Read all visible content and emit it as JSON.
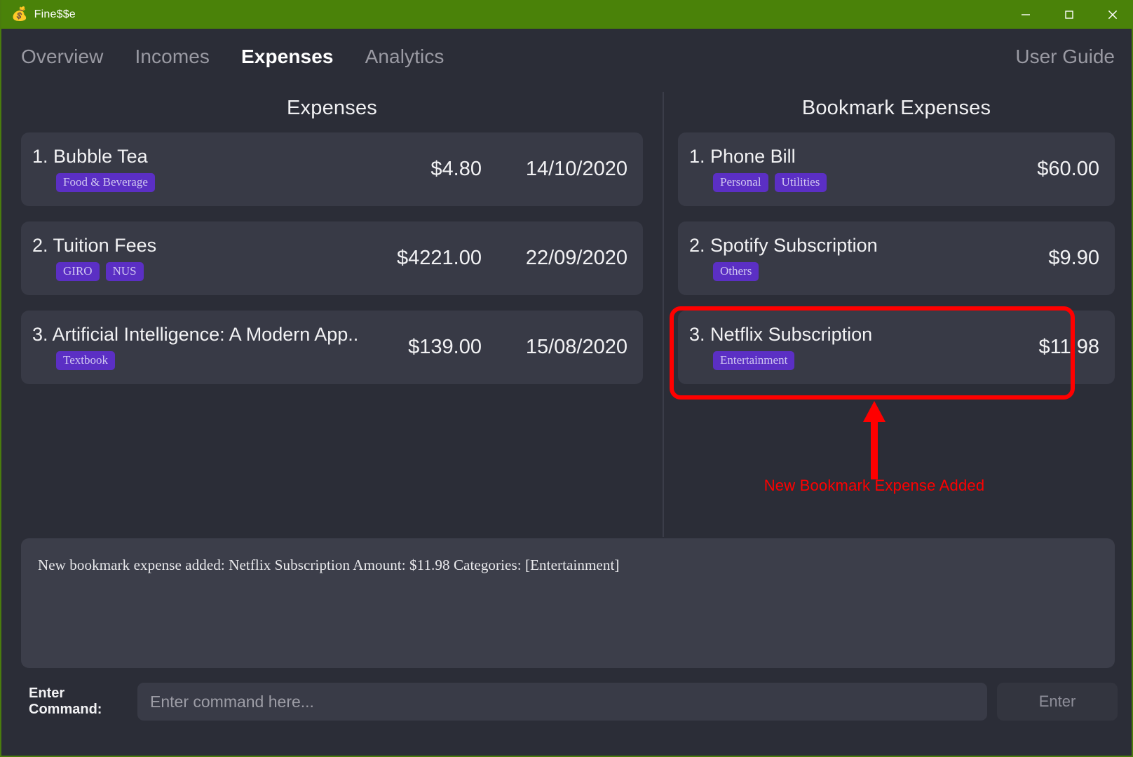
{
  "window": {
    "icon": "money-bag-icon",
    "title": "Fine$$e",
    "controls": {
      "minimize": "minimize-icon",
      "maximize": "maximize-icon",
      "close": "close-icon"
    },
    "titlebar_color": "#4a8209"
  },
  "nav": {
    "tabs": [
      {
        "label": "Overview",
        "active": false
      },
      {
        "label": "Incomes",
        "active": false
      },
      {
        "label": "Expenses",
        "active": true
      },
      {
        "label": "Analytics",
        "active": false
      }
    ],
    "right_link": "User Guide"
  },
  "panels": {
    "expenses": {
      "heading": "Expenses",
      "items": [
        {
          "index": "1.",
          "title": "Bubble Tea",
          "tags": [
            "Food & Beverage"
          ],
          "amount": "$4.80",
          "date": "14/10/2020"
        },
        {
          "index": "2.",
          "title": "Tuition Fees",
          "tags": [
            "GIRO",
            "NUS"
          ],
          "amount": "$4221.00",
          "date": "22/09/2020"
        },
        {
          "index": "3.",
          "title": "Artificial Intelligence: A Modern App...",
          "tags": [
            "Textbook"
          ],
          "amount": "$139.00",
          "date": "15/08/2020"
        }
      ]
    },
    "bookmark_expenses": {
      "heading": "Bookmark Expenses",
      "items": [
        {
          "index": "1.",
          "title": "Phone Bill",
          "tags": [
            "Personal",
            "Utilities"
          ],
          "amount": "$60.00",
          "highlighted": false
        },
        {
          "index": "2.",
          "title": "Spotify Subscription",
          "tags": [
            "Others"
          ],
          "amount": "$9.90",
          "highlighted": false
        },
        {
          "index": "3.",
          "title": "Netflix Subscription",
          "tags": [
            "Entertainment"
          ],
          "amount": "$11.98",
          "highlighted": true
        }
      ]
    }
  },
  "console": {
    "lines": [
      "New bookmark expense added: Netflix Subscription Amount: $11.98 Categories: [Entertainment]"
    ]
  },
  "command_bar": {
    "label": "Enter Command:",
    "input_value": "",
    "input_placeholder": "Enter command here...",
    "button_label": "Enter"
  },
  "annotation": {
    "color": "#ff0000",
    "text": "New Bookmark Expense Added",
    "arrow": "up-arrow-icon",
    "target": "Netflix Subscription bookmark card"
  },
  "colors": {
    "titlebar_green": "#4a8209",
    "background": "#2b2d37",
    "card": "#383a46",
    "tag_purple": "#5b2fc4",
    "annotation_red": "#ff0000"
  }
}
